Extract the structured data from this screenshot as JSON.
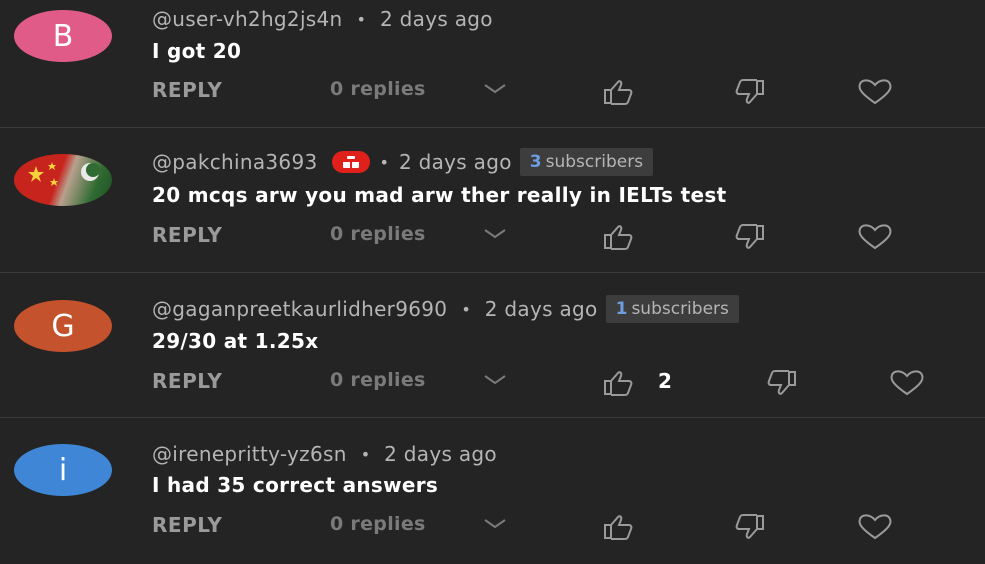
{
  "comments": [
    {
      "avatar_letter": "B",
      "avatar_color": "#e15b89",
      "handle": "@user-vh2hg2js4n",
      "time": "2 days ago",
      "text": "I got 20",
      "reply_label": "REPLY",
      "replies_label": "0 replies"
    },
    {
      "avatar_letter": "",
      "handle": "@pakchina3693",
      "time": "2 days ago",
      "subscribers_count": "3",
      "subscribers_label": "subscribers",
      "text": "20 mcqs arw you mad arw ther really in IELTs test",
      "reply_label": "REPLY",
      "replies_label": "0 replies"
    },
    {
      "avatar_letter": "G",
      "avatar_color": "#c4522c",
      "handle": "@gaganpreetkaurlidher9690",
      "time": "2 days ago",
      "subscribers_count": "1",
      "subscribers_label": "subscribers",
      "text": "29/30 at 1.25x",
      "reply_label": "REPLY",
      "replies_label": "0 replies",
      "like_count": "2"
    },
    {
      "avatar_letter": "i",
      "avatar_color": "#3f87d6",
      "handle": "@irenepritty-yz6sn",
      "time": "2 days ago",
      "text": "I had 35 correct answers",
      "reply_label": "REPLY",
      "replies_label": "0 replies"
    }
  ],
  "separator": "•",
  "icons": [
    "thumbs-up-icon",
    "thumbs-down-icon",
    "heart-icon",
    "chevron-down-icon",
    "gift-badge-icon"
  ]
}
